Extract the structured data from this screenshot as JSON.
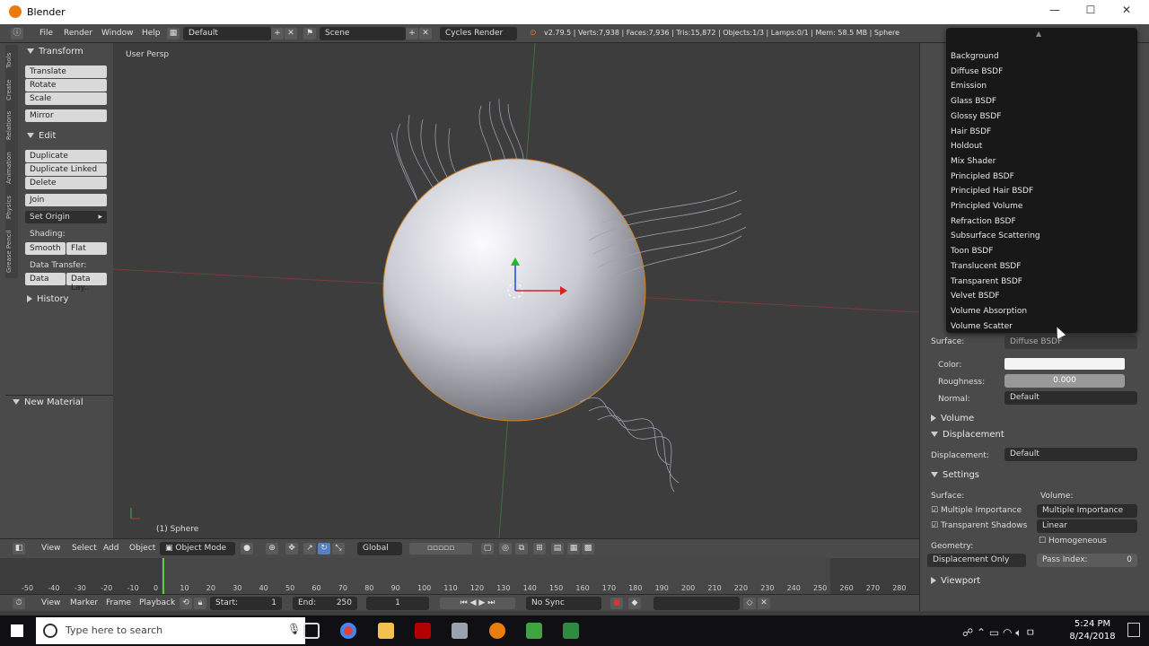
{
  "window": {
    "title": "Blender",
    "min": "—",
    "max": "☐",
    "close": "✕"
  },
  "topbar": {
    "menus": [
      "File",
      "Render",
      "Window",
      "Help"
    ],
    "layout": "Default",
    "scene": "Scene",
    "engine": "Cycles Render",
    "stats": "v2.79.5 | Verts:7,938 | Faces:7,936 | Tris:15,872 | Objects:1/3 | Lamps:0/1 | Mem: 58.5 MB | Sphere"
  },
  "tabs": [
    "Tools",
    "Create",
    "Relations",
    "Animation",
    "Physics",
    "Grease Pencil"
  ],
  "toolshelf": {
    "transform_head": "Transform",
    "transform": [
      "Translate",
      "Rotate",
      "Scale"
    ],
    "mirror": "Mirror",
    "edit_head": "Edit",
    "edit": [
      "Duplicate",
      "Duplicate Linked",
      "Delete"
    ],
    "join": "Join",
    "set_origin": "Set Origin",
    "shading_label": "Shading:",
    "smooth": "Smooth",
    "flat": "Flat",
    "data_transfer_label": "Data Transfer:",
    "data": "Data",
    "data_lay": "Data Lay..",
    "history": "History",
    "new_material": "New Material"
  },
  "viewport": {
    "label": "User Persp",
    "object": "(1) Sphere"
  },
  "vp_header": {
    "view": "View",
    "select": "Select",
    "add": "Add",
    "object": "Object",
    "mode": "Object Mode",
    "orientation": "Global"
  },
  "timeline": {
    "ticks": [
      "-50",
      "-40",
      "-30",
      "-20",
      "-10",
      "0",
      "10",
      "20",
      "30",
      "40",
      "50",
      "60",
      "70",
      "80",
      "90",
      "100",
      "110",
      "120",
      "130",
      "140",
      "150",
      "160",
      "170",
      "180",
      "190",
      "200",
      "210",
      "220",
      "230",
      "240",
      "250",
      "260",
      "270",
      "280"
    ],
    "view": "View",
    "marker": "Marker",
    "frame": "Frame",
    "playback": "Playback",
    "start_label": "Start:",
    "start": "1",
    "end_label": "End:",
    "end": "250",
    "current": "1",
    "sync": "No Sync"
  },
  "menu": {
    "items": [
      "Background",
      "Diffuse BSDF",
      "Emission",
      "Glass BSDF",
      "Glossy BSDF",
      "Hair BSDF",
      "Holdout",
      "Mix Shader",
      "Principled BSDF",
      "Principled Hair BSDF",
      "Principled Volume",
      "Refraction BSDF",
      "Subsurface Scattering",
      "Toon BSDF",
      "Translucent BSDF",
      "Transparent BSDF",
      "Velvet BSDF",
      "Volume Absorption",
      "Volume Scatter"
    ]
  },
  "props": {
    "surface_label": "Surface:",
    "surface_value": "Diffuse BSDF",
    "color_label": "Color:",
    "roughness_label": "Roughness:",
    "roughness_value": "0.000",
    "normal_label": "Normal:",
    "normal_value": "Default",
    "volume_head": "Volume",
    "displacement_head": "Displacement",
    "displacement_label": "Displacement:",
    "displacement_value": "Default",
    "settings_head": "Settings",
    "s_surface_label": "Surface:",
    "s_volume_label": "Volume:",
    "multiple_importance": "Multiple Importance",
    "volume_mi": "Multiple Importance",
    "transparent_shadows": "Transparent Shadows",
    "linear": "Linear",
    "homogeneous": "Homogeneous",
    "geometry_label": "Geometry:",
    "disp_only": "Displacement Only",
    "pass_index_label": "Pass Index:",
    "pass_index": "0",
    "viewport_head": "Viewport"
  },
  "taskbar": {
    "search_placeholder": "Type here to search",
    "time": "5:24 PM",
    "date": "8/24/2018"
  },
  "colors": {
    "accent": "#e87d0d",
    "menu_bg": "#181818",
    "selected": "#f0a030"
  }
}
